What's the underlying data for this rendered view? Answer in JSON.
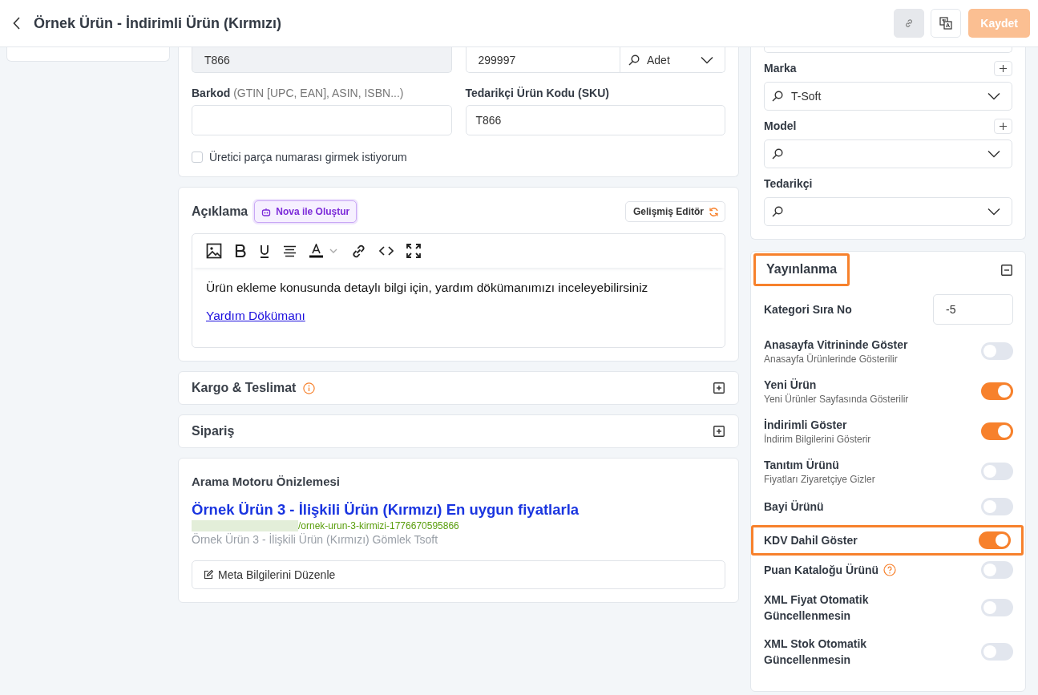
{
  "header": {
    "title": "Örnek Ürün - İndirimli Ürün (Kırmızı)",
    "save_button": "Kaydet",
    "save_disabled": true
  },
  "product_fields": {
    "stock_code": {
      "value": "T866",
      "disabled": true
    },
    "quantity": {
      "value": "299997",
      "unit": "Adet"
    },
    "barcode": {
      "label": "Barkod",
      "hint": "(GTIN [UPC, EAN], ASIN, ISBN...)"
    },
    "sku": {
      "label": "Tedarikçi Ürün Kodu (SKU)",
      "value": "T866"
    },
    "mpn_checkbox": {
      "label": "Üretici parça numarası girmek istiyorum",
      "checked": false
    }
  },
  "description": {
    "title": "Açıklama",
    "ai_button": "Nova ile Oluştur",
    "editor_button": "Gelişmiş Editör",
    "text": "Ürün ekleme konusunda detaylı bilgi için, yardım dökümanımızı inceleyebilirsiniz",
    "link": "Yardım Dökümanı"
  },
  "sections": [
    {
      "title": "Kargo & Teslimat",
      "info": true,
      "expanded": false
    },
    {
      "title": "Sipariş",
      "info": false,
      "expanded": false
    }
  ],
  "seo": {
    "title": "Arama Motoru Önizlemesi",
    "page_title": "Örnek Ürün 3 - İlişkili Ürün (Kırmızı) En uygun fiyatlarla",
    "url": "/ornek-urun-3-kirmizi-1776670595866",
    "description": "Örnek Ürün 3 - İlişkili Ürün (Kırmızı) Gömlek Tsoft",
    "edit_button": "Meta Bilgilerini Düzenle"
  },
  "brand_fields": [
    {
      "label": "Marka",
      "value": "T-Soft",
      "addable": true
    },
    {
      "label": "Model",
      "addable": true
    },
    {
      "label": "Tedarikçi",
      "addable": false
    }
  ],
  "publishing": {
    "title": "Yayınlanma",
    "highlighted": true,
    "expanded": true,
    "order": {
      "label": "Kategori Sıra No",
      "value": "-5"
    },
    "toggles": [
      {
        "label": "Anasayfa Vitrininde Göster",
        "subtitle": "Anasayfa Ürünlerinde Gösterilir",
        "on": false,
        "highlighted": false,
        "help": false
      },
      {
        "label": "Yeni Ürün",
        "subtitle": "Yeni Ürünler Sayfasında Gösterilir",
        "on": true,
        "highlighted": false,
        "help": false
      },
      {
        "label": "İndirimli Göster",
        "subtitle": "İndirim Bilgilerini Gösterir",
        "on": true,
        "highlighted": false,
        "help": false
      },
      {
        "label": "Tanıtım Ürünü",
        "subtitle": "Fiyatları Ziyaretçiye Gizler",
        "on": false,
        "highlighted": false,
        "help": false
      },
      {
        "label": "Bayi Ürünü",
        "on": false,
        "highlighted": false,
        "help": false
      },
      {
        "label": "KDV Dahil Göster",
        "on": true,
        "highlighted": true,
        "help": false
      },
      {
        "label": "Puan Kataloğu Ürünü",
        "on": false,
        "highlighted": false,
        "help": true
      },
      {
        "label": "XML Fiyat Otomatik Güncellenmesin",
        "on": false,
        "highlighted": false,
        "help": false
      },
      {
        "label": "XML Stok Otomatik Güncellenmesin",
        "on": false,
        "highlighted": false,
        "help": false
      }
    ]
  }
}
